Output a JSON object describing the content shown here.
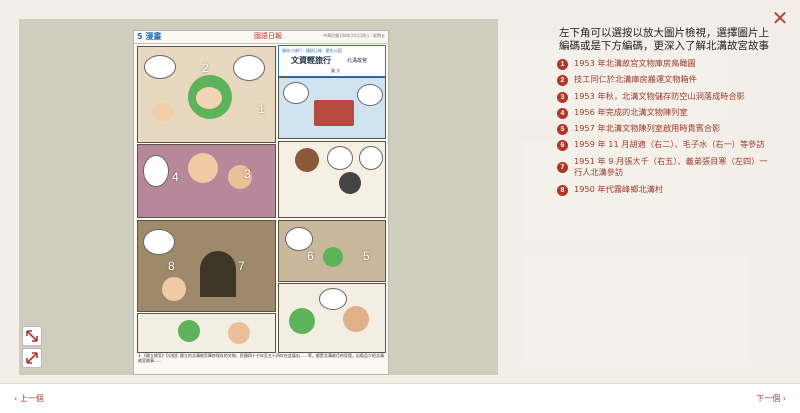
{
  "comic": {
    "section_label": "5 漫畫",
    "logo_text": "國語日報",
    "header_date": "中華民國108年10月18日／星期五",
    "title_small": "繪本小旅行 ‧ 國語日報 ‧ 歷史公園",
    "title": "文資輕旅行",
    "subtitle": "北溝故宮",
    "author": "圖‧文",
    "panel_numbers": [
      "2",
      "1",
      "4",
      "3",
      "8",
      "7",
      "6",
      "5"
    ],
    "caption": "1.《國立故宮》【分組】國立的北溝故宮庫房保存的文物，民國四十七年至五十四年在此展出……等，都是北溝歲月的見證。出版品介紹北溝故宮故事……"
  },
  "controls": {
    "zoom_in_icon": "expand-diagonal-icon",
    "zoom_out_icon": "shrink-diagonal-icon",
    "close_icon": "close-x-icon",
    "close_symbol": "✕"
  },
  "info": {
    "heading": "左下角可以選按以放大圖片檢視，選擇圖片上編碼或是下方編碼，更深入了解北溝故宮故事"
  },
  "items": [
    {
      "n": "1",
      "text": "1953 年北溝故宮文物庫房鳥瞰圖"
    },
    {
      "n": "2",
      "text": "技工同仁於北溝庫房搬運文物箱件"
    },
    {
      "n": "3",
      "text": "1953 年秋，北溝文物儲存防空山洞落成時合影"
    },
    {
      "n": "4",
      "text": "1956 年完成的北溝文物陳列室"
    },
    {
      "n": "5",
      "text": "1957 年北溝文物陳列室啟用時貴賓合影"
    },
    {
      "n": "6",
      "text": "1959 年 11 月胡適（右二）、毛子水（右一）等參訪"
    },
    {
      "n": "7",
      "text": "1951 年 9 月張大千（右五）、義弟張目寒（左四）一行人北溝參訪"
    },
    {
      "n": "8",
      "text": "1950 年代霧峰鄉北溝村"
    }
  ],
  "nav": {
    "prev": "‹  上一個",
    "next": "下一個  ›"
  },
  "colors": {
    "accent": "#b03628",
    "link": "#9e3b2f"
  }
}
